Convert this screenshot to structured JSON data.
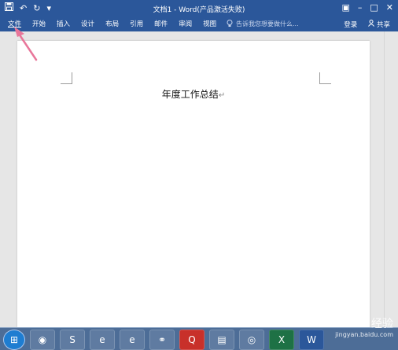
{
  "window": {
    "title": "文档1 - Word(产品激活失败)",
    "quick_access": {
      "save_icon": "save-icon",
      "undo_glyph": "↶",
      "redo_glyph": "↻",
      "customize_glyph": "▾"
    },
    "controls": {
      "ribbon_display": "▣",
      "minimize": "–",
      "maximize": "□",
      "close": "✕"
    }
  },
  "ribbon": {
    "tabs": [
      "文件",
      "开始",
      "插入",
      "设计",
      "布局",
      "引用",
      "邮件",
      "审阅",
      "视图"
    ],
    "tell_me_icon": "lightbulb-icon",
    "tell_me": "告诉我您想要做什么...",
    "sign_in": "登录",
    "share": "共享"
  },
  "document": {
    "title": "年度工作总结",
    "paragraph_mark": "↵"
  },
  "taskbar": {
    "items": [
      {
        "name": "start-button",
        "glyph": "⊞"
      },
      {
        "name": "chrome-icon",
        "glyph": "◉"
      },
      {
        "name": "sogou-icon",
        "glyph": "S"
      },
      {
        "name": "ie-icon",
        "glyph": "e"
      },
      {
        "name": "ie2-icon",
        "glyph": "e"
      },
      {
        "name": "network-icon",
        "glyph": "⚭"
      },
      {
        "name": "red-app-icon",
        "glyph": "Q"
      },
      {
        "name": "file-explorer-icon",
        "glyph": "▤"
      },
      {
        "name": "wechat-icon",
        "glyph": "◎"
      },
      {
        "name": "excel-icon",
        "glyph": "X"
      },
      {
        "name": "word-icon",
        "glyph": "W"
      }
    ]
  },
  "watermark": {
    "brand": "Bai 经验",
    "url": "jingyan.baidu.com"
  },
  "colors": {
    "accent": "#2b579a",
    "arrow": "#e8769a",
    "taskbar": "#4d6d97"
  }
}
